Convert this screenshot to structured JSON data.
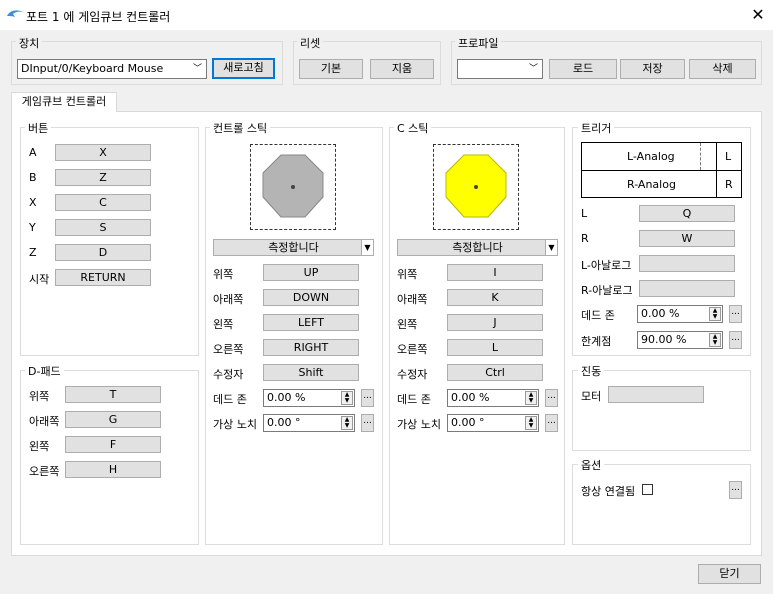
{
  "window": {
    "title": "포트 1 에 게임큐브 컨트롤러",
    "close": "✕"
  },
  "device": {
    "group": "장치",
    "selected": "DInput/0/Keyboard Mouse",
    "refresh": "새로고침"
  },
  "reset": {
    "group": "리셋",
    "default": "기본",
    "clear": "지움"
  },
  "profile": {
    "group": "프로파일",
    "selected": "",
    "load": "로드",
    "save": "저장",
    "delete": "삭제"
  },
  "tab": {
    "label": "게임큐브 컨트롤러"
  },
  "buttons": {
    "group": "버튼",
    "rows": [
      {
        "label": "A",
        "key": "X"
      },
      {
        "label": "B",
        "key": "Z"
      },
      {
        "label": "X",
        "key": "C"
      },
      {
        "label": "Y",
        "key": "S"
      },
      {
        "label": "Z",
        "key": "D"
      },
      {
        "label": "시작",
        "key": "RETURN"
      }
    ]
  },
  "dpad": {
    "group": "D-패드",
    "rows": [
      {
        "label": "위쪽",
        "key": "T"
      },
      {
        "label": "아래쪽",
        "key": "G"
      },
      {
        "label": "왼쪽",
        "key": "F"
      },
      {
        "label": "오른쪽",
        "key": "H"
      }
    ]
  },
  "main_stick": {
    "group": "컨트롤 스틱",
    "calibrate": "측정합니다",
    "rows": [
      {
        "label": "위쪽",
        "key": "UP"
      },
      {
        "label": "아래쪽",
        "key": "DOWN"
      },
      {
        "label": "왼쪽",
        "key": "LEFT"
      },
      {
        "label": "오른쪽",
        "key": "RIGHT"
      },
      {
        "label": "수정자",
        "key": "Shift"
      }
    ],
    "deadzone_label": "데드 존",
    "deadzone_value": "0.00 %",
    "notch_label": "가상 노치",
    "notch_value": "0.00 °",
    "more": "...",
    "color": "#b4b4b4"
  },
  "c_stick": {
    "group": "C 스틱",
    "calibrate": "측정합니다",
    "rows": [
      {
        "label": "위쪽",
        "key": "I"
      },
      {
        "label": "아래쪽",
        "key": "K"
      },
      {
        "label": "왼쪽",
        "key": "J"
      },
      {
        "label": "오른쪽",
        "key": "L"
      },
      {
        "label": "수정자",
        "key": "Ctrl"
      }
    ],
    "deadzone_label": "데드 존",
    "deadzone_value": "0.00 %",
    "notch_label": "가상 노치",
    "notch_value": "0.00 °",
    "more": "...",
    "color": "#ffff00"
  },
  "triggers": {
    "group": "트리거",
    "l_analog": "L-Analog",
    "l_short": "L",
    "r_analog": "R-Analog",
    "r_short": "R",
    "rows": [
      {
        "label": "L",
        "key": "Q"
      },
      {
        "label": "R",
        "key": "W"
      },
      {
        "label": "L-아날로그",
        "key": ""
      },
      {
        "label": "R-아날로그",
        "key": ""
      }
    ],
    "deadzone_label": "데드 존",
    "deadzone_value": "0.00 %",
    "threshold_label": "한계점",
    "threshold_value": "90.00 %",
    "more": "..."
  },
  "rumble": {
    "group": "진동",
    "motor_label": "모터",
    "motor_key": ""
  },
  "options": {
    "group": "옵션",
    "always_connected": "항상 연결됨",
    "checked": false,
    "more": "..."
  },
  "footer": {
    "close": "닫기"
  }
}
